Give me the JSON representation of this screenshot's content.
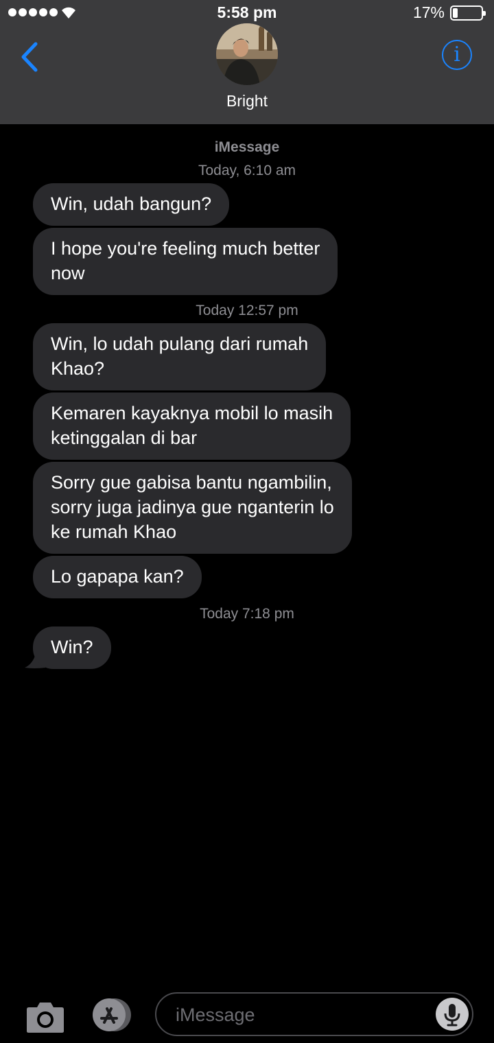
{
  "status_bar": {
    "time": "5:58 pm",
    "battery_percent": "17%",
    "battery_level": 0.17
  },
  "header": {
    "contact_name": "Bright",
    "back_icon": "chevron-left-icon",
    "info_icon": "info-icon",
    "info_glyph": "i",
    "accent_color": "#1a84ff"
  },
  "conversation": {
    "service_label": "iMessage",
    "groups": [
      {
        "timestamp": "Today, 6:10 am",
        "messages": [
          "Win, udah bangun?",
          "I hope you're feeling much better\nnow"
        ]
      },
      {
        "timestamp": "Today 12:57 pm",
        "messages": [
          "Win, lo udah pulang dari rumah\nKhao?",
          "Kemaren kayaknya mobil lo masih\nketinggalan di bar",
          "Sorry gue gabisa bantu ngambilin,\nsorry juga jadinya gue nganterin lo\nke rumah Khao",
          "Lo gapapa kan?"
        ]
      },
      {
        "timestamp": "Today 7:18 pm",
        "messages": [
          "Win?"
        ]
      }
    ]
  },
  "input_bar": {
    "placeholder": "iMessage",
    "camera_icon": "camera-icon",
    "appstore_icon": "app-store-icon",
    "mic_icon": "microphone-icon"
  }
}
